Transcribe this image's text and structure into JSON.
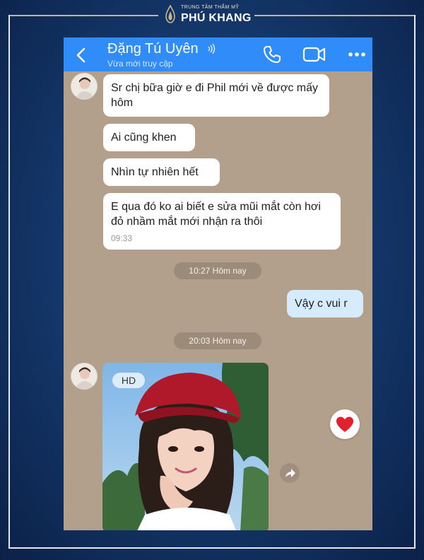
{
  "brand": {
    "tagline": "TRUNG TÂM THẨM MỸ",
    "name": "PHÚ KHANG"
  },
  "colors": {
    "background": "#153a6e",
    "accent_gold": "#c9b78a",
    "topbar_blue": "#2f8cf8",
    "chat_bg": "#b2a08d",
    "my_bubble": "#d6ecfd",
    "heart": "#e2202f"
  },
  "chat": {
    "header": {
      "back_icon": "chevron-left-icon",
      "contact_name": "Đặng Tú Uyên",
      "contact_status": "Vừa mới truy cập",
      "sound_icon": "sound-wave-icon",
      "call_icon": "phone-icon",
      "video_icon": "video-camera-icon",
      "more_icon": "more-dots-icon"
    },
    "messages": [
      {
        "text": "Sr chị bữa giờ e đi Phil mới về được mấy hôm"
      },
      {
        "text": "Ai cũng khen"
      },
      {
        "text": "Nhìn tự nhiên hết"
      },
      {
        "text": "E qua đó ko ai biết e sửa mũi mắt còn hơi đỏ nhầm mắt mới nhận ra thôi",
        "time": "09:33"
      }
    ],
    "separators": [
      {
        "label": "10:27 Hôm nay"
      },
      {
        "label": "20:03 Hôm nay"
      }
    ],
    "my_message": {
      "text": "Vậy c vui r"
    },
    "photo": {
      "badge": "HD"
    },
    "reactions": {
      "heart_icon": "heart-icon",
      "share_icon": "share-icon"
    }
  }
}
